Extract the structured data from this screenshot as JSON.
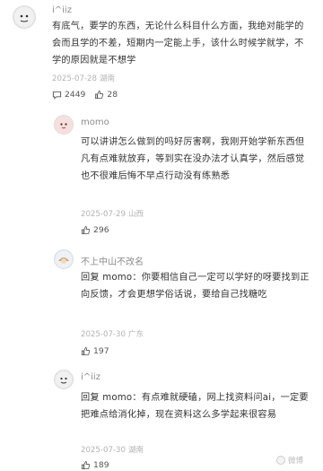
{
  "comments": [
    {
      "username": "i^iiz",
      "text": "有底气，要学的东西，无论什么科目什么方面，我绝对能学的会而且学的不差，短期内一定能上手，该什么时候学就学，不学的原因就是不想学",
      "date": "2025-07-28",
      "location": "湖南",
      "replies": "2449",
      "likes": "28"
    },
    {
      "username": "momo",
      "text": "可以讲讲怎么做到的吗好厉害啊，我刚开始学新东西但凡有点难就放弃，等到实在没办法才认真学，然后感觉也不很难后悔不早点行动没有练熟悉",
      "date": "2025-07-29",
      "location": "山西",
      "likes": "296"
    },
    {
      "username": "不上中山不改名",
      "reply_prefix": "回复",
      "mention": "momo",
      "text": "：你要相信自己一定可以学好的呀要找到正向反馈，才会更想学俗话说，要给自己找糖吃",
      "date": "2025-07-30",
      "location": "广东",
      "likes": "197"
    },
    {
      "username": "i^iiz",
      "reply_prefix": "回复",
      "mention": "momo",
      "text": "：有点难就硬磕，网上找资料问ai，一定要把难点给消化掉，现在资料这么多学起来很容易",
      "date": "2025-07-30",
      "location": "湖南",
      "likes": "189"
    }
  ],
  "watermark": "微博"
}
